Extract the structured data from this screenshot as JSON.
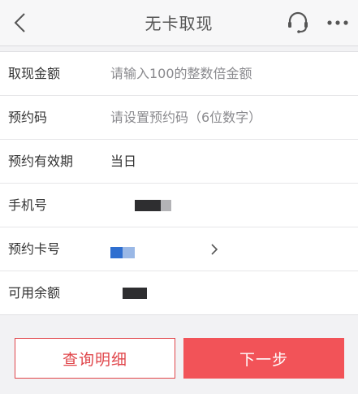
{
  "header": {
    "title": "无卡取现",
    "back_icon": "chevron-left-icon",
    "service_icon": "headset-icon",
    "more_icon": "more-dots-icon"
  },
  "form": {
    "amount": {
      "label": "取现金额",
      "placeholder": "请输入100的整数倍金额"
    },
    "code": {
      "label": "预约码",
      "placeholder": "请设置预约码（6位数字）"
    },
    "validity": {
      "label": "预约有效期",
      "value": "当日"
    },
    "phone": {
      "label": "手机号"
    },
    "card": {
      "label": "预约卡号"
    },
    "balance": {
      "label": "可用余额"
    }
  },
  "actions": {
    "details_label": "查询明细",
    "next_label": "下一步"
  },
  "colors": {
    "accent": "#f25358",
    "accent_border": "#e0454a",
    "background": "#f2f2f4"
  }
}
